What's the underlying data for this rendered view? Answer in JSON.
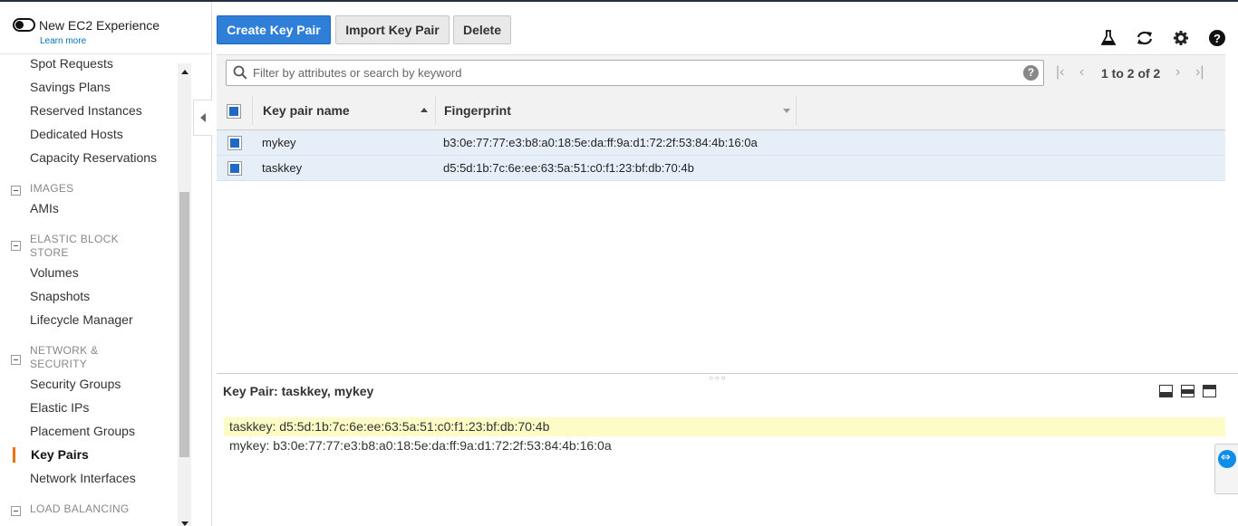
{
  "experience": {
    "title": "New EC2 Experience",
    "learn_more": "Learn more"
  },
  "nav": {
    "items_top": [
      "Spot Requests",
      "Savings Plans",
      "Reserved Instances",
      "Dedicated Hosts",
      "Capacity Reservations"
    ],
    "images_section": "IMAGES",
    "images_items": [
      "AMIs"
    ],
    "ebs_section": "ELASTIC BLOCK STORE",
    "ebs_items": [
      "Volumes",
      "Snapshots",
      "Lifecycle Manager"
    ],
    "network_section": "NETWORK & SECURITY",
    "network_items": [
      "Security Groups",
      "Elastic IPs",
      "Placement Groups",
      "Key Pairs",
      "Network Interfaces"
    ],
    "active": "Key Pairs",
    "lb_section": "LOAD BALANCING"
  },
  "toolbar": {
    "create_label": "Create Key Pair",
    "import_label": "Import Key Pair",
    "delete_label": "Delete",
    "icons": [
      "flask-icon",
      "refresh-icon",
      "gear-icon",
      "help-icon"
    ]
  },
  "search": {
    "placeholder": "Filter by attributes or search by keyword",
    "value": "",
    "help": "?"
  },
  "pager": {
    "text": "1 to 2 of 2"
  },
  "table": {
    "columns": [
      "Key pair name",
      "Fingerprint"
    ],
    "rows": [
      {
        "name": "mykey",
        "fingerprint": "b3:0e:77:77:e3:b8:a0:18:5e:da:ff:9a:d1:72:2f:53:84:4b:16:0a",
        "selected": true
      },
      {
        "name": "taskkey",
        "fingerprint": "d5:5d:1b:7c:6e:ee:63:5a:51:c0:f1:23:bf:db:70:4b",
        "selected": true
      }
    ]
  },
  "detail": {
    "title": "Key Pair: taskkey, mykey",
    "lines": [
      "taskkey: d5:5d:1b:7c:6e:ee:63:5a:51:c0:f1:23:bf:db:70:4b",
      "mykey: b3:0e:77:77:e3:b8:a0:18:5e:da:ff:9a:d1:72:2f:53:84:4b:16:0a"
    ]
  },
  "colors": {
    "primary": "#2f7ed8",
    "active_accent": "#ec7211",
    "selected_row": "#e6eff8",
    "highlight": "#fdfbc6"
  }
}
